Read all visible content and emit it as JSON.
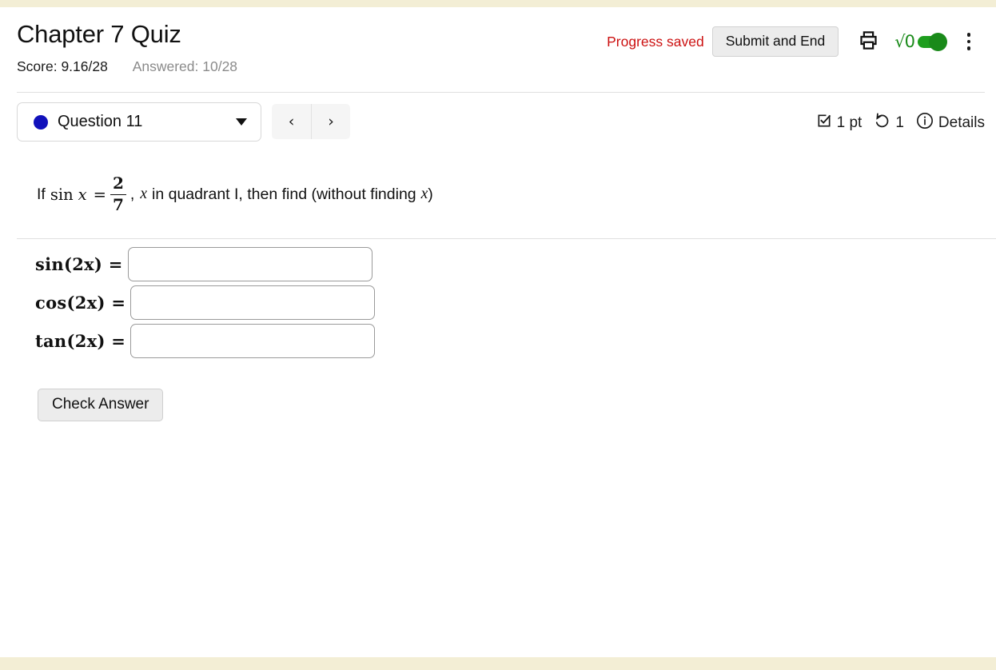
{
  "theme": {
    "strip_color": "#f3eed5",
    "page_bg": "#ffffff",
    "alert_color": "#cc1111",
    "toggle_on_color": "#1a8a1a",
    "question_dot_color": "#1111bb",
    "muted_text_color": "#8a8a8a"
  },
  "header": {
    "title": "Chapter 7 Quiz",
    "score_label": "Score: 9.16/28",
    "answered_label": "Answered: 10/28",
    "progress_status": "Progress saved",
    "submit_label": "Submit and End",
    "print_icon": "printer-icon",
    "math_toggle_glyph": "√0",
    "math_toggle_state": "on",
    "overflow_icon": "kebab-menu-icon"
  },
  "question_bar": {
    "selected_question": "Question 11",
    "status_dot": "answered",
    "dropdown_icon": "chevron-down-icon",
    "prev_label": "‹",
    "next_label": "›",
    "meta": {
      "points_icon": "checkbox-check-icon",
      "points_label": "1 pt",
      "attempts_icon": "retry-arrow-icon",
      "attempts_label": "1",
      "details_icon": "info-circle-icon",
      "details_label": "Details"
    }
  },
  "problem": {
    "prefix": "If",
    "fn": "sin",
    "var": "x",
    "equals": "=",
    "fraction": {
      "numerator": "2",
      "denominator": "7"
    },
    "comma": ",",
    "middle": "in quadrant I, then find (without finding",
    "trailing_var": "x",
    "close_paren": ")"
  },
  "answers": {
    "rows": [
      {
        "label": "sin(2x) =",
        "value": "",
        "placeholder": ""
      },
      {
        "label": "cos(2x) =",
        "value": "",
        "placeholder": ""
      },
      {
        "label": "tan(2x) =",
        "value": "",
        "placeholder": ""
      }
    ],
    "check_label": "Check Answer"
  }
}
